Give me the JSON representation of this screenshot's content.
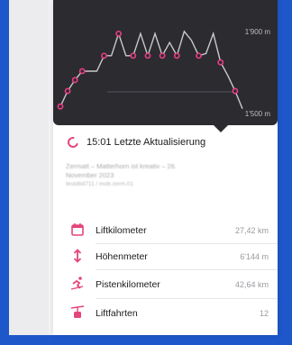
{
  "chart": {
    "axis_top_label": "1'900 m",
    "axis_bottom_label": "1'500 m",
    "line_color": "#c9c9cc",
    "marker_color": "#ea3f88",
    "background": "#2b2b30"
  },
  "chart_data": {
    "type": "line",
    "ylim": [
      1500,
      1900
    ],
    "yticks": [
      "1'900 m",
      "1'500 m"
    ],
    "series": [
      {
        "values": [
          1540,
          1610,
          1660,
          1700,
          1700,
          1700,
          1770,
          1770,
          1870,
          1770,
          1770,
          1870,
          1770,
          1870,
          1770,
          1830,
          1770,
          1880,
          1840,
          1770,
          1780,
          1870,
          1740,
          1680,
          1610,
          1530
        ]
      }
    ]
  },
  "refresh": {
    "text": "15:01 Letzte Aktualisierung"
  },
  "subtitle": {
    "line1": "Zermatt – Matterhorn ist kreativ – 26.",
    "line2": "November 2023",
    "line3": "testdb4711 / mob.zerm.01"
  },
  "stats": [
    {
      "icon": "calendar-icon",
      "label": "Liftkilometer",
      "value": "27,42 km"
    },
    {
      "icon": "up-down-arrow-icon",
      "label": "Höhenmeter",
      "value": "6'144 m"
    },
    {
      "icon": "skier-icon",
      "label": "Pistenkilometer",
      "value": "42,64 km"
    },
    {
      "icon": "chairlift-icon",
      "label": "Liftfahrten",
      "value": "12"
    }
  ],
  "colors": {
    "accent": "#e4457b",
    "frame": "#1d57c9"
  }
}
